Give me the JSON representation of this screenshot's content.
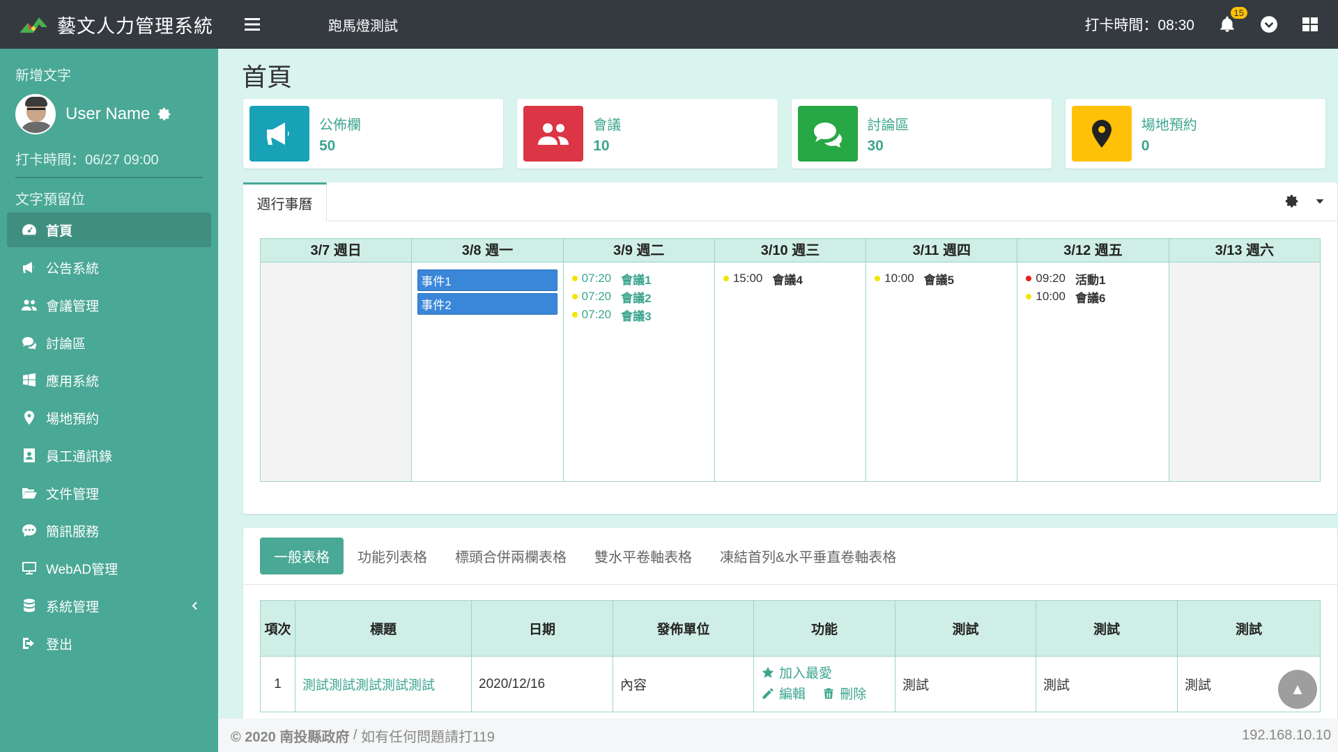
{
  "app": {
    "name": "藝文人力管理系統"
  },
  "topbar": {
    "marquee": "跑馬燈測試",
    "clock": "打卡時間：08:30",
    "badge": "15"
  },
  "user": {
    "caption": "新增文字",
    "name": "User Name",
    "punch": "打卡時間：06/27 09:00"
  },
  "sidebar": {
    "section": "文字預留位",
    "items": [
      {
        "label": "首頁",
        "icon": "dashboard-icon"
      },
      {
        "label": "公告系統",
        "icon": "megaphone-icon"
      },
      {
        "label": "會議管理",
        "icon": "users-icon"
      },
      {
        "label": "討論區",
        "icon": "comments-icon"
      },
      {
        "label": "應用系統",
        "icon": "windows-icon"
      },
      {
        "label": "場地預約",
        "icon": "map-pin-icon"
      },
      {
        "label": "員工通訊錄",
        "icon": "contact-book-icon"
      },
      {
        "label": "文件管理",
        "icon": "folder-open-icon"
      },
      {
        "label": "簡訊服務",
        "icon": "sms-icon"
      },
      {
        "label": "WebAD管理",
        "icon": "monitor-icon"
      },
      {
        "label": "系統管理",
        "icon": "database-icon"
      },
      {
        "label": "登出",
        "icon": "sign-out-icon"
      }
    ]
  },
  "page": {
    "title": "首頁"
  },
  "cards": [
    {
      "label": "公佈欄",
      "value": "50",
      "color": "#17a2b8",
      "icon": "megaphone-icon"
    },
    {
      "label": "會議",
      "value": "10",
      "color": "#dc3545",
      "icon": "users-icon"
    },
    {
      "label": "討論區",
      "value": "30",
      "color": "#28a745",
      "icon": "comments-icon"
    },
    {
      "label": "場地預約",
      "value": "0",
      "color": "#ffc107",
      "icon": "map-pin-icon"
    }
  ],
  "calendar": {
    "tab": "週行事曆",
    "days": [
      {
        "label": "3/7 週日"
      },
      {
        "label": "3/8 週一"
      },
      {
        "label": "3/9 週二"
      },
      {
        "label": "3/10 週三"
      },
      {
        "label": "3/11 週四"
      },
      {
        "label": "3/12 週五"
      },
      {
        "label": "3/13 週六"
      }
    ],
    "blocks": [
      "事件1",
      "事件2"
    ],
    "events": {
      "tue": [
        {
          "time": "07:20",
          "title": "會議1"
        },
        {
          "time": "07:20",
          "title": "會議2"
        },
        {
          "time": "07:20",
          "title": "會議3"
        }
      ],
      "wed": [
        {
          "time": "15:00",
          "title": "會議4"
        }
      ],
      "thu": [
        {
          "time": "10:00",
          "title": "會議5"
        }
      ],
      "fri": [
        {
          "time": "09:20",
          "title": "活動1",
          "dot": "#e02020"
        },
        {
          "time": "10:00",
          "title": "會議6",
          "dot": "#f2e600"
        }
      ]
    },
    "dot_yellow": "#f2e600",
    "dot_red": "#e02020"
  },
  "table_tabs": [
    "一般表格",
    "功能列表格",
    "標頭合併兩欄表格",
    "雙水平卷軸表格",
    "凍結首列&水平垂直卷軸表格"
  ],
  "table": {
    "headers": [
      "項次",
      "標題",
      "日期",
      "發佈單位",
      "功能",
      "測試",
      "測試",
      "測試"
    ],
    "row": {
      "no": "1",
      "title": "測試測試測試測試測試",
      "date": "2020/12/16",
      "unit": "內容",
      "fav": "加入最愛",
      "edit": "編輯",
      "del": "刪除",
      "t1": "測試",
      "t2": "測試",
      "t3": "測試"
    }
  },
  "footer": {
    "copy": "© 2020 南投縣政府",
    "sep": " / ",
    "note": "如有任何問題請打119",
    "ip": "192.168.10.10"
  },
  "to_top": "▲"
}
